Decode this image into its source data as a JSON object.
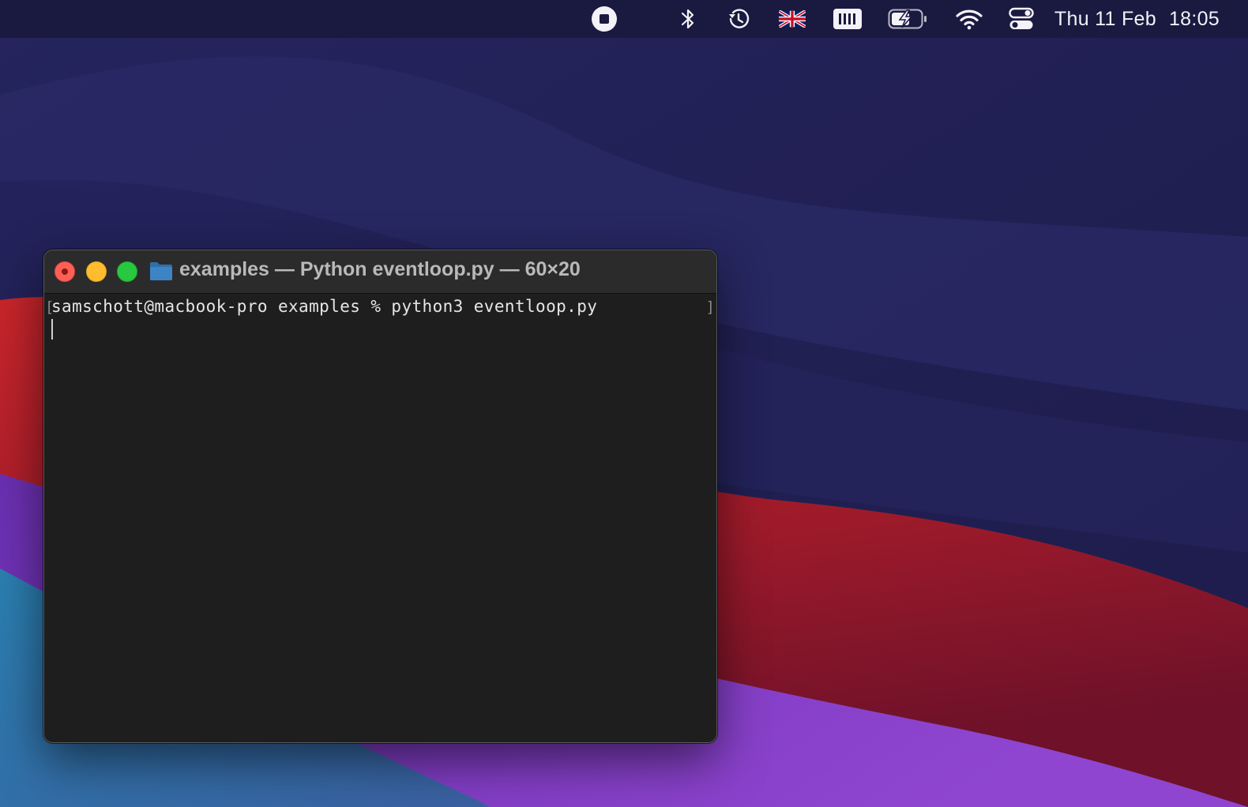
{
  "menubar": {
    "icons": [
      "screen-recording-stop-icon",
      "bluetooth-icon",
      "time-machine-icon",
      "uk-flag-input-source-icon",
      "memory-meter-icon",
      "battery-charging-icon",
      "wifi-icon",
      "control-center-icon"
    ],
    "clock_date": "Thu 11 Feb",
    "clock_time": "18:05"
  },
  "terminal": {
    "title": "examples — Python eventloop.py — 60×20",
    "lines": [
      "samschott@macbook-pro examples % python3 eventloop.py"
    ],
    "mark_left": "[",
    "mark_right": "]"
  },
  "colors": {
    "close": "#fe5f57",
    "minimize": "#febc2e",
    "zoom": "#28c840",
    "terminal_bg": "#1e1e1e",
    "titlebar_bg": "#2c2b2c",
    "folder": "#3d84c6"
  }
}
